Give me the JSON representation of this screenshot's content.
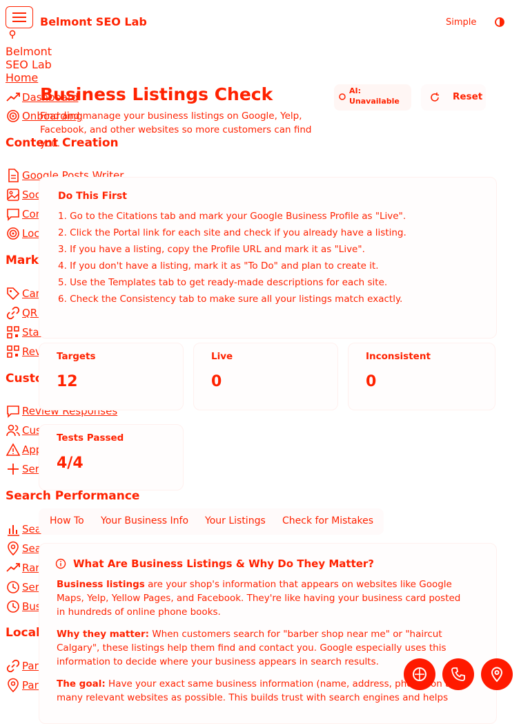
{
  "header": {
    "brand": "Belmont SEO Lab",
    "mode_label": "Simple"
  },
  "sidebar": {
    "brand_line1": "Belmont",
    "brand_line2": "SEO Lab",
    "home": "Home",
    "top_items": [
      {
        "label": "Dashboard",
        "icon": "trending-up-icon"
      },
      {
        "label": "Onboarding",
        "icon": "target-icon"
      }
    ],
    "sections": [
      {
        "title": "Content Creation",
        "items": [
          {
            "label": "Google Posts Writer",
            "icon": "document-icon"
          },
          {
            "label": "Social Media Studio",
            "icon": "image-icon"
          },
          {
            "label": "Content Calendar",
            "icon": "message-icon"
          },
          {
            "label": "Local Content Ideas",
            "icon": "target-icon"
          }
        ]
      },
      {
        "title": "Marketing & Tracking",
        "items": [
          {
            "label": "Campaign Links",
            "icon": "tag-icon"
          },
          {
            "label": "QR Code Maker",
            "icon": "link-icon"
          },
          {
            "label": "Staff Referral Codes",
            "icon": "qr-code-icon"
          },
          {
            "label": "Review Request Links",
            "icon": "qr-code-icon"
          }
        ]
      },
      {
        "title": "Customer Management",
        "items": [
          {
            "label": "Review Responses",
            "icon": "message-icon"
          },
          {
            "label": "Customer Analysis",
            "icon": "users-icon"
          },
          {
            "label": "Appointment Reminders",
            "icon": "alert-icon"
          },
          {
            "label": "Service Suggestions",
            "icon": "plus-icon"
          }
        ]
      },
      {
        "title": "Search Performance",
        "items": [
          {
            "label": "Search Performance",
            "icon": "bar-chart-icon"
          },
          {
            "label": "Search Rankings",
            "icon": "map-pin-icon"
          },
          {
            "label": "Ranking Monitor",
            "icon": "trending-up-icon"
          },
          {
            "label": "Service Areas",
            "icon": "clock-icon"
          },
          {
            "label": "Busy Times Predictor",
            "icon": "clock-icon"
          }
        ]
      },
      {
        "title": "Local Partnerships",
        "items": [
          {
            "label": "Partner Finder",
            "icon": "link-icon"
          },
          {
            "label": "Partnership Map",
            "icon": "map-pin-icon"
          }
        ]
      }
    ]
  },
  "page": {
    "title": "Business Listings Check",
    "subtitle": "Find and manage your business listings on Google, Yelp, Facebook, and other websites so more customers can find you.",
    "ai_badge_line1": "AI:",
    "ai_badge_line2": "Unavailable",
    "reset_label": "Reset"
  },
  "quick_start": {
    "title": "Do This First",
    "steps": [
      "1. Go to the Citations tab and mark your Google Business Profile as \"Live\".",
      "2. Click the Portal link for each site and check if you already have a listing.",
      "3. If you have a listing, copy the Profile URL and mark it as \"Live\".",
      "4. If you don't have a listing, mark it as \"To Do\" and plan to create it.",
      "5. Use the Templates tab to get ready-made descriptions for each site.",
      "6. Check the Consistency tab to make sure all your listings match exactly."
    ]
  },
  "stats": [
    {
      "label": "Targets",
      "value": "12"
    },
    {
      "label": "Live",
      "value": "0"
    },
    {
      "label": "Inconsistent",
      "value": "0"
    },
    {
      "label": "Tests Passed",
      "value": "4/4"
    }
  ],
  "tabs": [
    "How To",
    "Your Business Info",
    "Your Listings",
    "Check for Mistakes"
  ],
  "article": {
    "heading": "What Are Business Listings & Why Do They Matter?",
    "p1_bold": "Business listings",
    "p1_rest": " are your shop's information that appears on websites like Google Maps, Yelp, Yellow Pages, and Facebook. They're like having your business card posted in hundreds of online phone books.",
    "p2_bold": "Why they matter:",
    "p2_rest": " When customers search for \"barber shop near me\" or \"haircut Calgary\", these listings help them find and contact you. Google especially uses this information to decide where your business appears in search results.",
    "p3_bold": "The goal:",
    "p3_rest": " Have your exact same business information (name, address, phone) on as many relevant websites as possible. This builds trust with search engines and helps"
  },
  "colors": {
    "accent": "#ff2200",
    "fab": "#ff1a00"
  }
}
